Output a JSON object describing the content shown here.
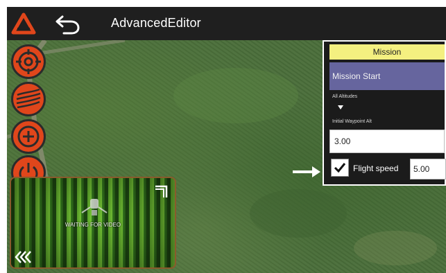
{
  "app": {
    "title": "AdvancedEditor",
    "logo_icon": "tower-logo-icon",
    "back_icon": "undo-arrow-icon",
    "accent_color": "#e0461b"
  },
  "left_toolbar": {
    "buttons": [
      {
        "name": "target-mode-icon"
      },
      {
        "name": "survey-field-icon"
      },
      {
        "name": "add-waypoint-icon"
      },
      {
        "name": "power-icon"
      }
    ]
  },
  "video": {
    "message": "WAITING FOR VIDEO",
    "expand_icon": "expand-corner-icon",
    "collapse_icon": "triple-chevron-left-icon"
  },
  "mission_panel": {
    "header": "Mission",
    "selected_item": "Mission Start",
    "altitude_label": "All Altitudes",
    "initial_waypoint_label": "Initial Waypoint Alt",
    "initial_waypoint_value": "3.00",
    "flight_speed_label": "Flight speed",
    "flight_speed_checked": true,
    "flight_speed_value": "5.00",
    "header_color": "#f4f080",
    "selected_color": "#66659e"
  },
  "annotation": {
    "arrow_icon": "white-arrow-right-icon"
  }
}
